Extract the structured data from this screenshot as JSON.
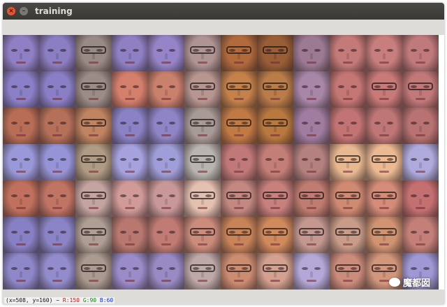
{
  "window": {
    "title": "training",
    "close_glyph": "×",
    "minimize_glyph": "–"
  },
  "status": {
    "coords": "(x=508, y=160) ~",
    "r": "R:150",
    "g": "G:90",
    "b": "B:60"
  },
  "watermark": {
    "text": "魔都囡",
    "icon": "wechat-icon"
  },
  "grid": {
    "rows": 7,
    "cols": 12,
    "tile_colors": [
      [
        "#8f7fc4",
        "#8b7ec2",
        "#9a8a86",
        "#8f80c4",
        "#9584c8",
        "#b09494",
        "#b06a3c",
        "#9a5e36",
        "#9c7a94",
        "#c47a78",
        "#c87e7c",
        "#c07a7c"
      ],
      [
        "#8b80c8",
        "#8a7fc6",
        "#9c8c88",
        "#d47f6c",
        "#c9806c",
        "#b89690",
        "#c4824a",
        "#ba7c48",
        "#a886a8",
        "#c47674",
        "#c87a78",
        "#c27878"
      ],
      [
        "#b86e56",
        "#b47058",
        "#c08460",
        "#8a82c4",
        "#8e84c6",
        "#a89a96",
        "#c27a44",
        "#b8783e",
        "#a07ca0",
        "#c27474",
        "#bf7676",
        "#b87272"
      ],
      [
        "#9a98d8",
        "#9694d6",
        "#b09c84",
        "#a6a2de",
        "#a09ed8",
        "#b8b4b0",
        "#c07878",
        "#c47e78",
        "#b48080",
        "#e8b890",
        "#ecba92",
        "#aeaadc"
      ],
      [
        "#c0705c",
        "#c07464",
        "#c4a4a0",
        "#d09a98",
        "#c89898",
        "#e4c0b0",
        "#c48880",
        "#c8807c",
        "#c07c70",
        "#d08a72",
        "#d48c78",
        "#c47070"
      ],
      [
        "#8880c4",
        "#8a84c6",
        "#ae9e94",
        "#b87870",
        "#c07c74",
        "#cc8c7c",
        "#c88458",
        "#d08a5c",
        "#c49890",
        "#c89c88",
        "#d09472",
        "#c48078"
      ],
      [
        "#8e88ca",
        "#928ccc",
        "#aa9a90",
        "#9a8cc8",
        "#988ac4",
        "#bea8a8",
        "#cc8c70",
        "#d4a090",
        "#b4a8d8",
        "#cc8c7c",
        "#d2967c",
        "#9e98d4"
      ]
    ],
    "glasses": [
      [
        0,
        0,
        1,
        0,
        0,
        1,
        1,
        1,
        0,
        0,
        0,
        0
      ],
      [
        0,
        0,
        1,
        0,
        0,
        1,
        1,
        1,
        0,
        0,
        1,
        1
      ],
      [
        0,
        0,
        1,
        0,
        0,
        1,
        1,
        1,
        0,
        0,
        0,
        0
      ],
      [
        0,
        0,
        1,
        0,
        0,
        1,
        0,
        0,
        0,
        1,
        1,
        0
      ],
      [
        0,
        0,
        1,
        0,
        0,
        1,
        1,
        1,
        1,
        1,
        1,
        0
      ],
      [
        0,
        0,
        1,
        0,
        0,
        1,
        1,
        1,
        1,
        1,
        1,
        0
      ],
      [
        0,
        0,
        1,
        0,
        0,
        1,
        1,
        1,
        0,
        1,
        1,
        0
      ]
    ]
  }
}
